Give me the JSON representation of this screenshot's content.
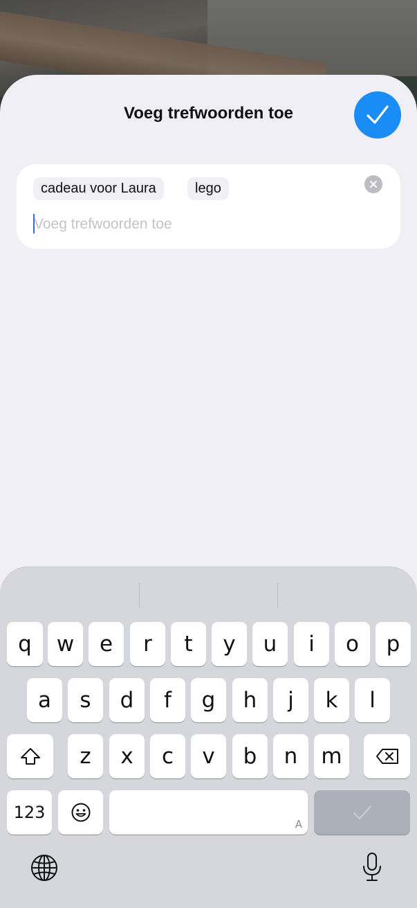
{
  "header": {
    "title": "Voeg trefwoorden toe"
  },
  "tags": {
    "chips": [
      "cadeau voor Laura",
      "lego"
    ],
    "placeholder": "Voeg trefwoorden toe",
    "value": ""
  },
  "keyboard": {
    "row1": [
      "q",
      "w",
      "e",
      "r",
      "t",
      "y",
      "u",
      "i",
      "o",
      "p"
    ],
    "row2": [
      "a",
      "s",
      "d",
      "f",
      "g",
      "h",
      "j",
      "k",
      "l"
    ],
    "row3": [
      "z",
      "x",
      "c",
      "v",
      "b",
      "n",
      "m"
    ],
    "numbers_label": "123",
    "space_hint": "A",
    "icons": {
      "shift": "shift-icon",
      "delete": "backspace-icon",
      "emoji": "emoji-icon",
      "return": "checkmark-icon",
      "globe": "globe-icon",
      "dictation": "microphone-icon"
    }
  },
  "colors": {
    "accent": "#1a8cf5",
    "sheet_bg": "#f0eff5",
    "keyboard_bg": "#d5d7dd"
  }
}
